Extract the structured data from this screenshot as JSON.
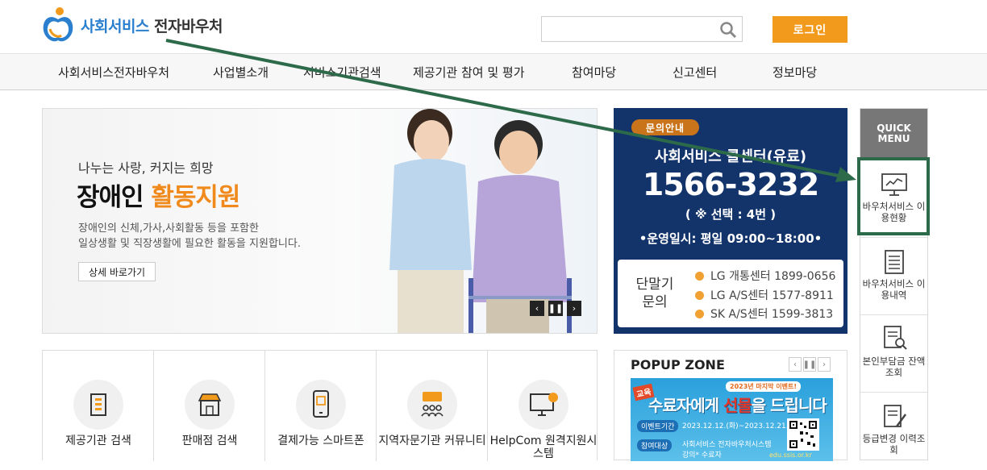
{
  "header": {
    "logo_primary": "사회서비스",
    "logo_secondary": "전자바우처",
    "search_placeholder": "",
    "login_label": "로그인"
  },
  "nav": [
    "사회서비스전자바우처",
    "사업별소개",
    "서비스기관검색",
    "제공기관 참여 및 평가",
    "참여마당",
    "신고센터",
    "정보마당"
  ],
  "banner": {
    "subtitle": "나누는 사랑, 커지는 희망",
    "title_plain": "장애인",
    "title_highlight": "활동지원",
    "desc_line1": "장애인의 신체,가사,사회활동 등을 포함한",
    "desc_line2": "일상생활 및 직장생활에 필요한 활동을 지원합니다.",
    "detail_button": "상세 바로가기",
    "prev": "‹",
    "pause": "❚❚",
    "next": "›"
  },
  "contact": {
    "badge": "문의안내",
    "center_name": "사회서비스 콜센터(유료)",
    "phone": "1566-3232",
    "select": "( ※ 선택 : 4번 )",
    "hours": "•운영일시: 평일 09:00~18:00•",
    "device_title": "단말기 문의",
    "lines": [
      "LG 개통센터 1899-0656",
      "LG A/S센터 1577-8911",
      "SK A/S센터 1599-3813"
    ]
  },
  "quick_menu": {
    "title": "QUICK MENU",
    "items": [
      {
        "label": "바우처서비스 이용현황",
        "icon": "monitor-chart-icon"
      },
      {
        "label": "바우처서비스 이용내역",
        "icon": "document-list-icon"
      },
      {
        "label": "본인부담금 잔액조회",
        "icon": "document-search-icon"
      },
      {
        "label": "등급변경 이력조회",
        "icon": "document-edit-icon"
      }
    ]
  },
  "services": [
    {
      "label": "제공기관 검색",
      "icon": "building-icon"
    },
    {
      "label": "판매점 검색",
      "icon": "store-icon"
    },
    {
      "label": "결제가능 스마트폰",
      "icon": "smartphone-icon"
    },
    {
      "label": "지역자문기관 커뮤니티",
      "icon": "community-icon"
    },
    {
      "label": "HelpCom 원격지원시스템",
      "icon": "remote-monitor-icon"
    }
  ],
  "popup": {
    "title": "POPUP ZONE",
    "prev": "‹",
    "pause": "❚❚",
    "next": "›",
    "event_top": "2023년 마지막 이벤트!",
    "edu": "교육",
    "headline_a": "수료자에게 ",
    "headline_b": "선물",
    "headline_c": "을 드립니다",
    "tag1": "이벤트기간",
    "txt1": "2023.12.12.(화)~2023.12.21.(목)",
    "tag2": "참여대상",
    "txt2": "사회서비스 전자바우처시스템",
    "txt3": "강의* 수료자",
    "url": "edu.ssis.or.kr"
  },
  "colors": {
    "accent_orange": "#f29a1c",
    "navy": "#13336b",
    "highlight_green": "#2d6a4a",
    "logo_blue": "#2b7fcf"
  }
}
